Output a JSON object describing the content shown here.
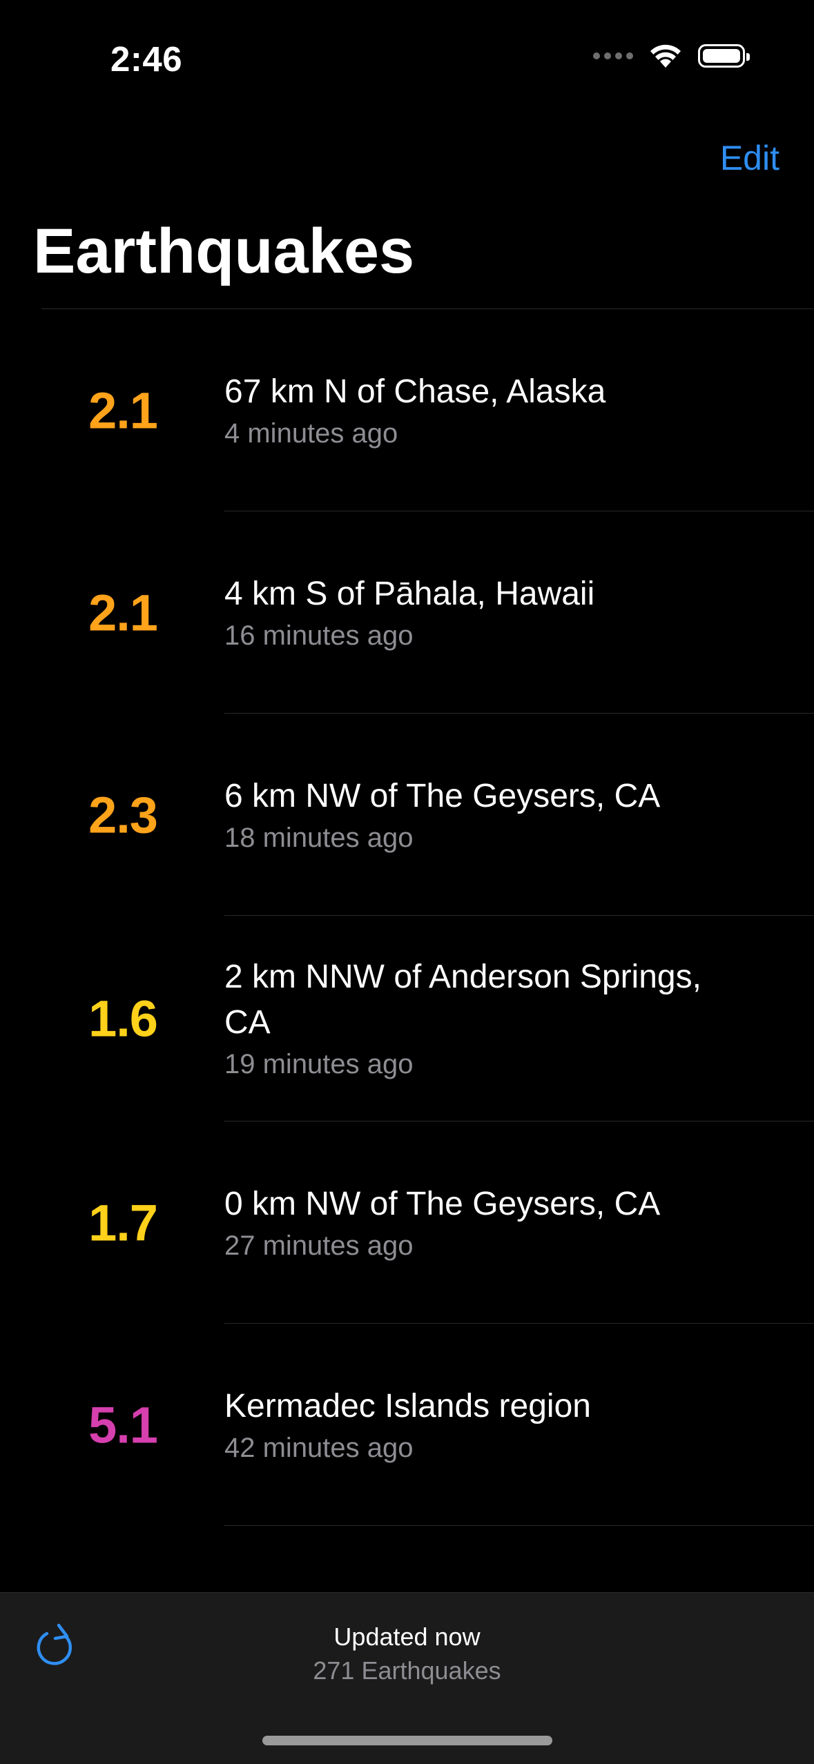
{
  "status_bar": {
    "time": "2:46"
  },
  "nav": {
    "edit_label": "Edit",
    "title": "Earthquakes"
  },
  "quakes": [
    {
      "magnitude": "2.1",
      "place": "67 km N of Chase, Alaska",
      "time": "4 minutes ago",
      "color": "#ffa31a"
    },
    {
      "magnitude": "2.1",
      "place": "4 km S of Pāhala, Hawaii",
      "time": "16 minutes ago",
      "color": "#ffa31a"
    },
    {
      "magnitude": "2.3",
      "place": "6 km NW of The Geysers, CA",
      "time": "18 minutes ago",
      "color": "#ffa31a"
    },
    {
      "magnitude": "1.6",
      "place": "2 km NNW of Anderson Springs, CA",
      "time": "19 minutes ago",
      "color": "#ffd11a"
    },
    {
      "magnitude": "1.7",
      "place": "0 km NW of The Geysers, CA",
      "time": "27 minutes ago",
      "color": "#ffd11a"
    },
    {
      "magnitude": "5.1",
      "place": "Kermadec Islands region",
      "time": "42 minutes ago",
      "color": "#d63fae"
    }
  ],
  "toolbar": {
    "refresh_icon": "arrow-clockwise-icon",
    "updated": "Updated now",
    "count": "271 Earthquakes"
  },
  "colors": {
    "accent": "#2f8ef2",
    "background": "#000000",
    "secondary_text": "#8d8d93"
  }
}
